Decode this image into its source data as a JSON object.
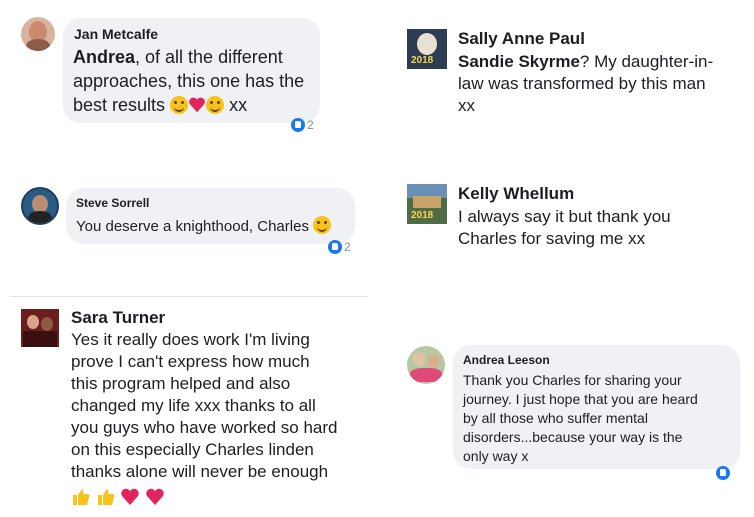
{
  "comments": [
    {
      "name": "Jan Metcalfe",
      "mention": "Andrea",
      "text": ", of all the different approaches, this one has the best results",
      "tail": "xx",
      "reaction_count": "2",
      "avatar_color": "#c98a70"
    },
    {
      "name": "Steve Sorrell",
      "text": "You deserve a knighthood, Charles",
      "reaction_count": "2",
      "avatar_color": "#2a5c86"
    },
    {
      "name": "Sara Turner",
      "text_lines": [
        "Yes it really does work I'm living",
        "prove I can't express how much",
        "this program helped and also",
        "changed my life xxx thanks to all",
        "you guys who have worked so hard",
        "on this especially Charles linden",
        "thanks alone will never be enough"
      ],
      "avatar_color": "#7a2a2a"
    },
    {
      "name": "Sally Anne Paul",
      "mention": "Sandie Skyrme",
      "text_lines": [
        "? My daughter-in-",
        "law was transformed by this man",
        "xx"
      ],
      "badge": "2018"
    },
    {
      "name": "Kelly Whellum",
      "text_lines": [
        "I always say it but thank you",
        "Charles for saving me xx"
      ],
      "badge": "2018"
    },
    {
      "name": "Andrea Leeson",
      "text_lines": [
        "Thank you Charles for sharing your",
        "journey.  I just hope that you are heard",
        "by all those who suffer mental",
        "disorders...because your way is the",
        "only way x"
      ],
      "avatar_color": "#c3a07a"
    }
  ],
  "icons": {
    "like": "like-icon",
    "smile": "grinning-face-icon",
    "heart": "red-heart-icon",
    "kiss": "kissing-face-icon",
    "thumb": "thumbs-up-icon"
  },
  "colors": {
    "bubble": "#eff1f4",
    "like_blue": "#1877f2",
    "heart_red": "#e0245e"
  }
}
